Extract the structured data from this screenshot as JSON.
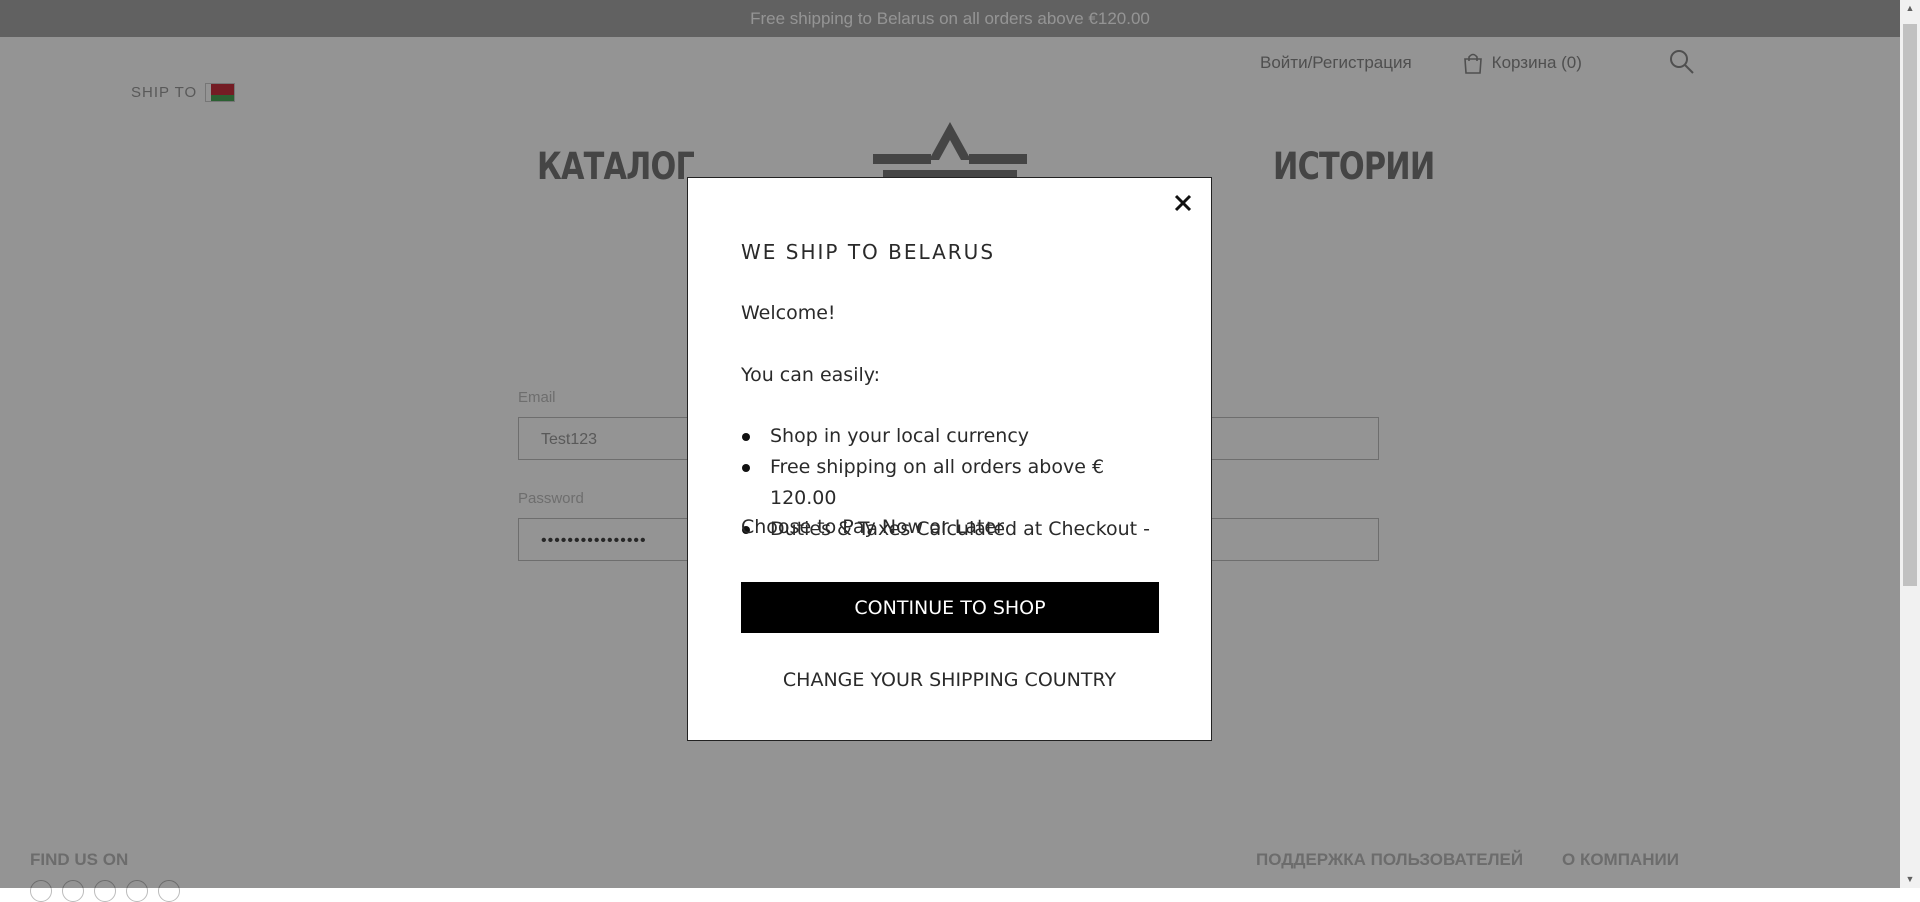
{
  "promo_bar": {
    "text": "Free shipping to Belarus on all orders above €120.00"
  },
  "header": {
    "ship_to_label": "SHIP TO",
    "login_label": "Войти/Регистрация",
    "cart_label": "Корзина (0)"
  },
  "nav": {
    "catalog": "КАТАЛОГ",
    "stories": "ИСТОРИИ"
  },
  "login_form": {
    "email_label": "Email",
    "email_value": "Test123",
    "password_label": "Password",
    "password_value": "••••••••••••••••"
  },
  "footer": {
    "find_us_label": "FIND US ON",
    "support_label": "ПОДДЕРЖКА ПОЛЬЗОВАТЕЛЕЙ",
    "about_label": "О КОМПАНИИ"
  },
  "modal": {
    "title": "WE SHIP TO BELARUS",
    "welcome": "Welcome!",
    "intro": "You can easily:",
    "benefits": [
      "Shop in your local currency",
      "Free shipping on all orders above € 120.00",
      "Duties & Taxes Calculated at Checkout -"
    ],
    "benefit_continuation": "Choose to Pay Now or Later",
    "continue_label": "CONTINUE TO SHOP",
    "change_country_label": "CHANGE YOUR SHIPPING COUNTRY"
  },
  "colors": {
    "overlay": "#000000",
    "button_bg": "#000000",
    "flag_red": "#c8313e",
    "flag_green": "#4aa657"
  },
  "icons": {
    "bag": "shopping-bag-icon",
    "search": "search-icon",
    "close": "close-icon",
    "logo": "brand-logo"
  }
}
